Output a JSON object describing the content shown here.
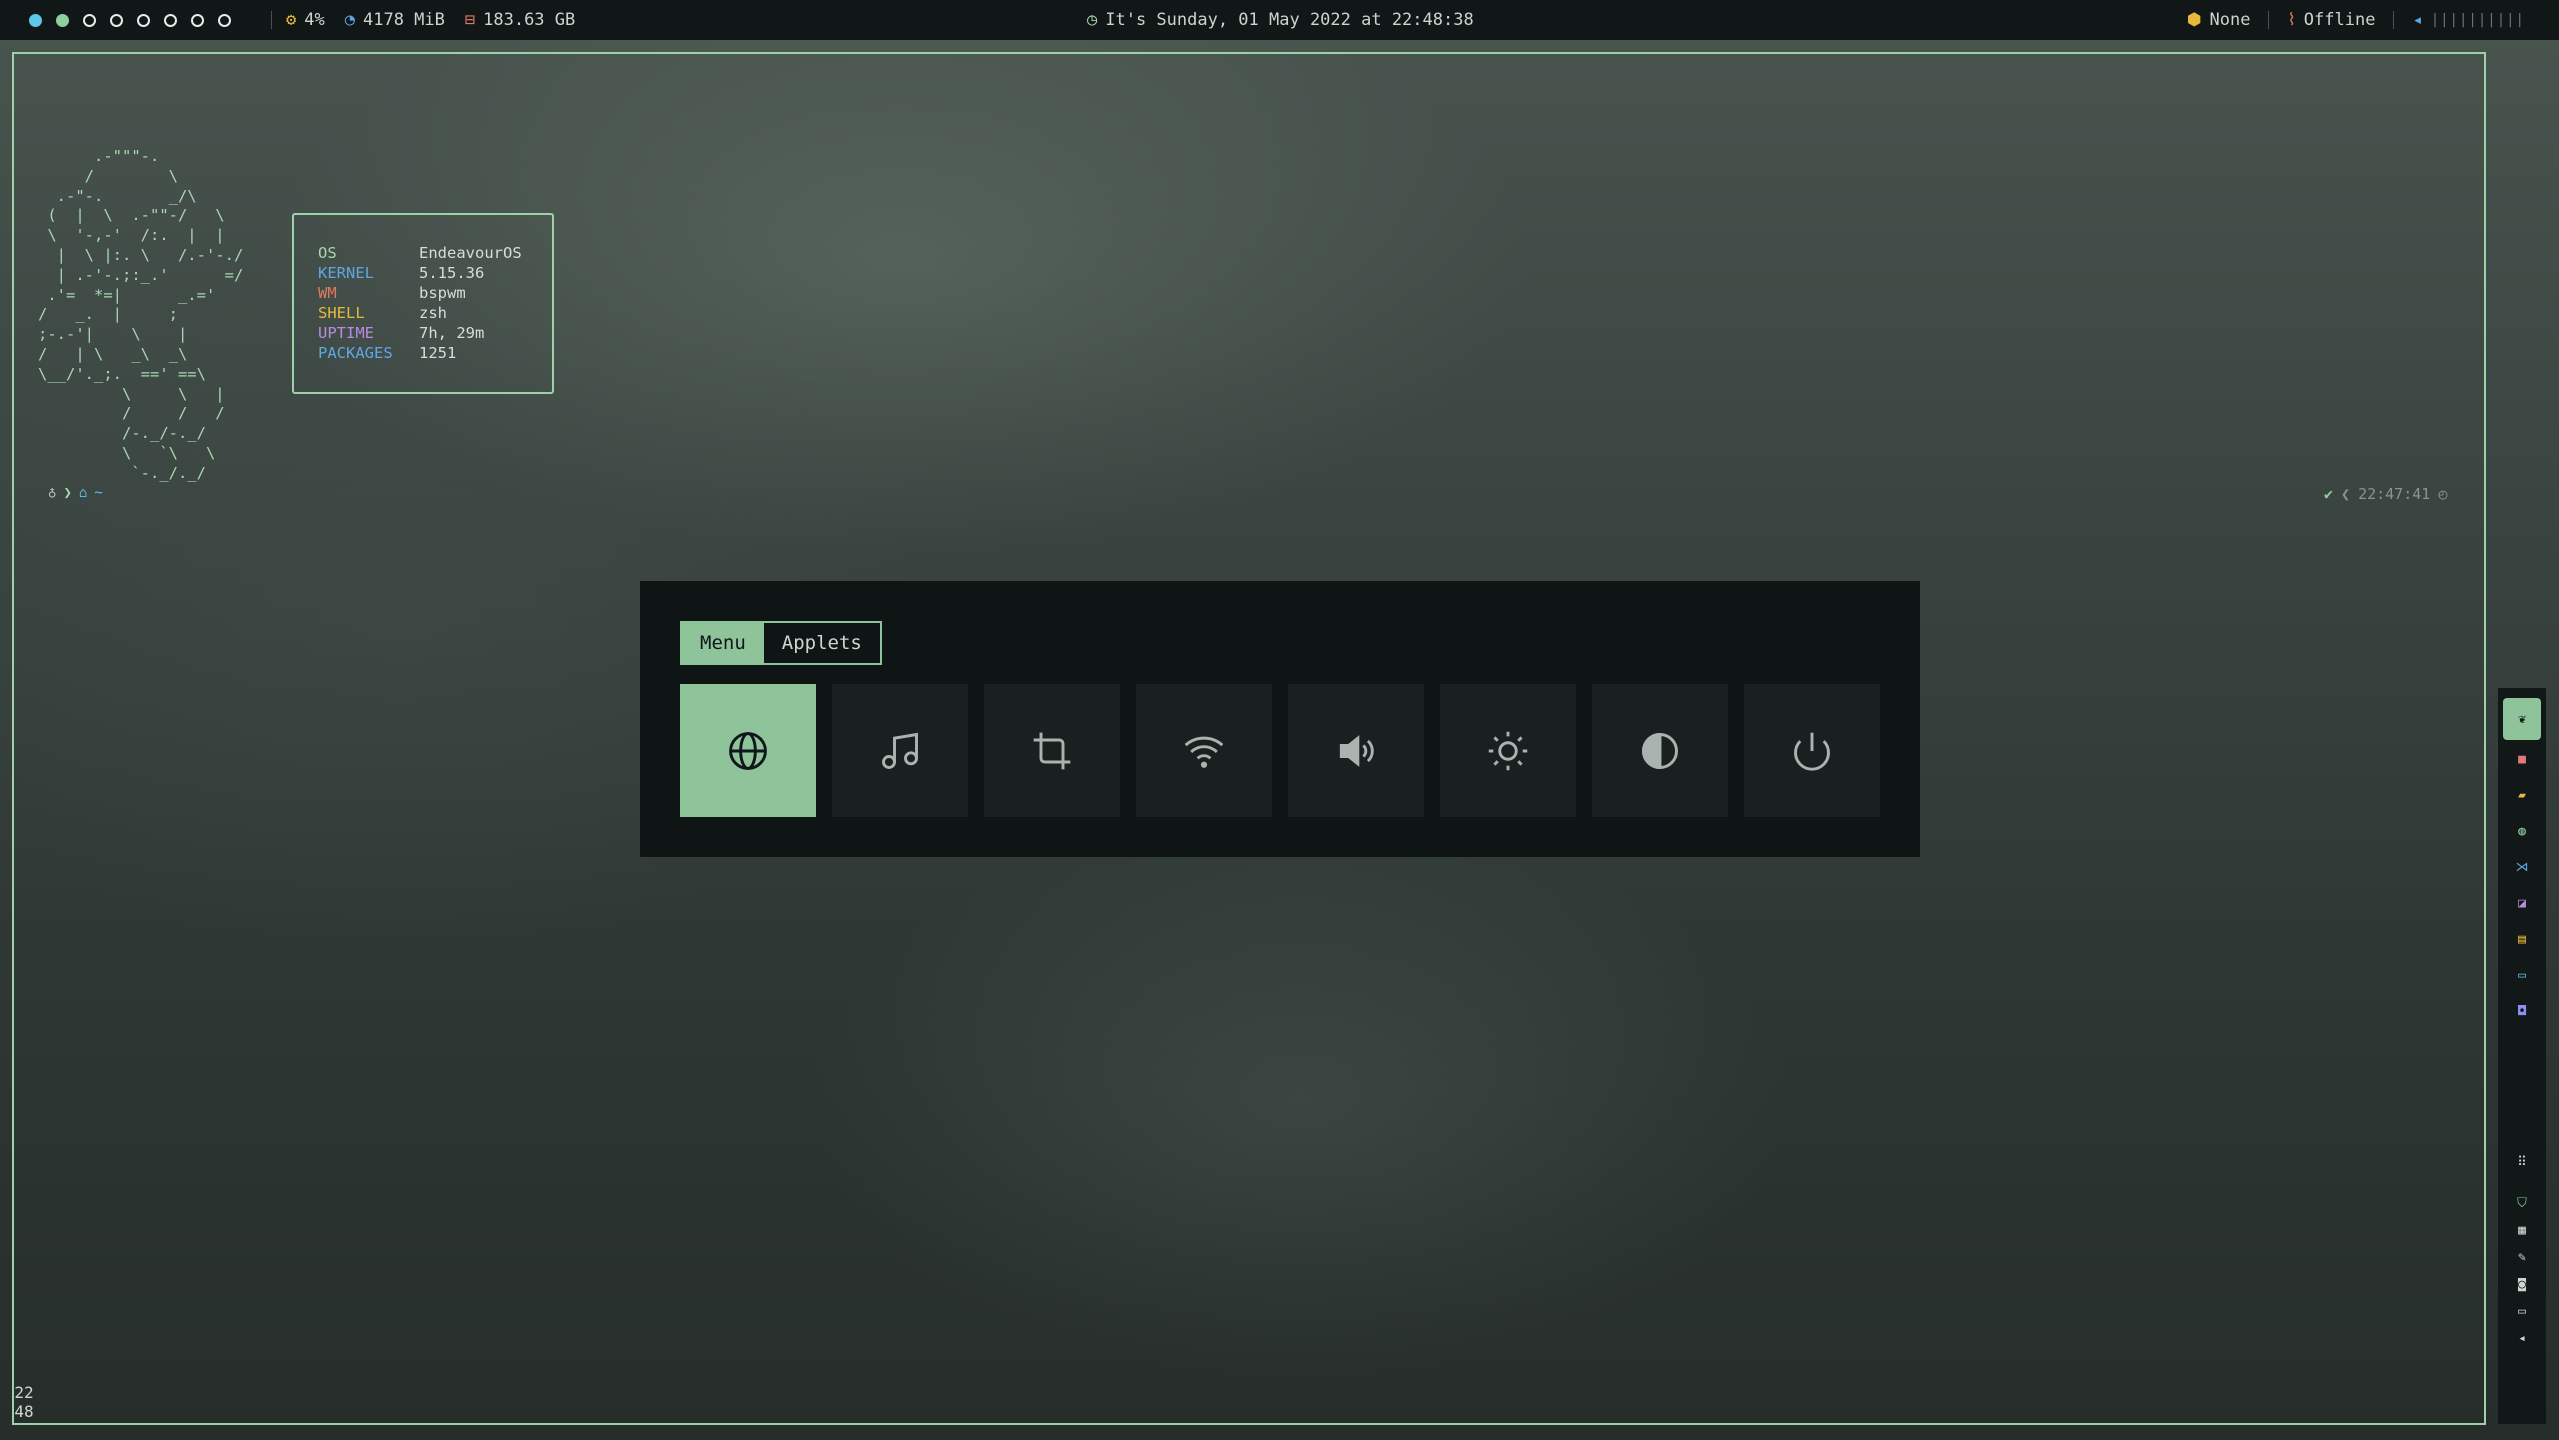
{
  "topbar": {
    "workspaces": [
      "ws1",
      "ws2",
      "ws3",
      "ws4",
      "ws5",
      "ws6",
      "ws7",
      "ws8"
    ],
    "cpu": "4%",
    "memory": "4178 MiB",
    "disk": "183.63 GB",
    "datetime": "It's Sunday, 01 May 2022 at 22:48:38",
    "updates": "None",
    "network": "Offline",
    "volume_level": 0.0
  },
  "terminal": {
    "ascii_art": "      .-\"\"\"-.\n     /        \\\n  .-\"-.       _/\\\n (  |  \\  .-\"\"-/   \\\n \\  '-,-'  /:.  |  |\n  |  \\ |:. \\   /.-'-./\n  | .-'-.;:_.'      =/\n .'=  *=|      _.='\n/   _.  |     ;\n;-.-'|    \\    |\n/   | \\   _\\  _\\\n\\__/'._;.  ==' ==\\\n         \\     \\   |\n         /     /   /\n         /-._/-._/\n         \\   `\\   \\\n          `-._/._/",
    "fetch": [
      {
        "key": "OS",
        "value": "EndeavourOS",
        "color": "#a8d8b0"
      },
      {
        "key": "KERNEL",
        "value": "5.15.36",
        "color": "#5fa7e3"
      },
      {
        "key": "WM",
        "value": "bspwm",
        "color": "#e07a5f"
      },
      {
        "key": "SHELL",
        "value": "zsh",
        "color": "#e6b93a"
      },
      {
        "key": "UPTIME",
        "value": "7h, 29m",
        "color": "#b88ce0"
      },
      {
        "key": "PACKAGES",
        "value": "1251",
        "color": "#5fa7e3"
      }
    ],
    "prompt_dir": "~",
    "right_prompt_time": "22:47:41"
  },
  "menu": {
    "tabs": [
      "Menu",
      "Applets"
    ],
    "selected_tab": 0,
    "tiles": [
      {
        "name": "globe-icon",
        "selected": true
      },
      {
        "name": "music-icon",
        "selected": false
      },
      {
        "name": "crop-icon",
        "selected": false
      },
      {
        "name": "wifi-icon",
        "selected": false
      },
      {
        "name": "volume-icon",
        "selected": false
      },
      {
        "name": "brightness-icon",
        "selected": false
      },
      {
        "name": "contrast-icon",
        "selected": false
      },
      {
        "name": "power-icon",
        "selected": false
      }
    ]
  },
  "dock": {
    "apps": [
      "leaf-icon",
      "mail-icon",
      "folder-icon",
      "browser-icon",
      "vscode-icon",
      "intellij-icon",
      "notes-icon",
      "terminal-icon",
      "discord-icon"
    ],
    "tray": [
      "apps-grid-icon",
      "shield-icon",
      "clipboard-icon",
      "pen-icon",
      "gamepad-icon",
      "monitor-icon",
      "speaker-icon"
    ],
    "clock_hour": "22",
    "clock_minute": "48"
  }
}
